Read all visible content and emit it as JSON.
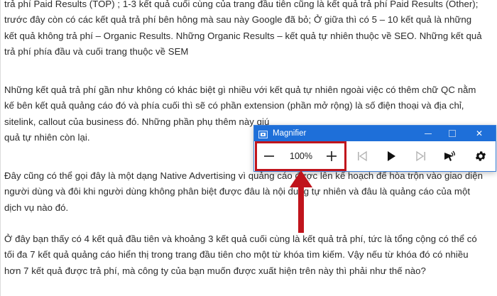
{
  "article": {
    "paragraphs": [
      {
        "lines": [
          "trả phí Paid Results (TOP) ; 1-3 kết quả cuối cùng của trang đầu tiên cũng là kết quả trả phí Paid Results (Other);",
          "trước đây còn có các kết quả trả phí bên hông mà sau này Google đã bỏ; Ở giữa thì có 5 – 10  kết quả là những",
          "kết quả không trả phí – Organic Results. Những Organic Results – kết quả tự nhiên thuộc về SEO. Những kết quả",
          "trả phí phía đầu và cuối trang thuộc về SEM"
        ]
      },
      {
        "lines": [
          "Những kết quả trả phí gần như không có khác biệt gì nhiều với kết quả tự nhiên ngoài việc có thêm chữ QC nằm",
          "kế bên kết quả quảng cáo đó và phía cuối thì sẽ có phần extension (phần mở rộng) là số điện thoại và địa chỉ,",
          "sitelink, callout của business đó. Những phần phụ thêm này giú",
          "quả tự nhiên còn lại."
        ]
      },
      {
        "lines": [
          "Đây cũng có thể gọi đây là một dạng Native Advertising vì quảng cáo được lên kế hoạch để hòa trộn vào giao diện",
          "người dùng và đôi khi người dùng không phân biệt được đâu là nội dung tự nhiên và đâu là quảng cáo của một",
          "dịch vụ nào đó."
        ]
      },
      {
        "lines": [
          "Ở đây bạn thấy có 4 kết quả đầu tiên và khoảng 3 kết quả cuối cùng là kết quả trả phí, tức là tổng cộng có thể có",
          "tối đa 7 kết quả quảng cáo hiển thị trong trang đầu tiên cho một từ khóa tìm kiếm. Vậy nếu từ khóa đó có nhiều",
          "hơn 7 kết quả được trả phí, mà công ty của bạn muốn được xuất hiện trên này thì phải như thế nào?"
        ]
      }
    ]
  },
  "magnifier": {
    "title": "Magnifier",
    "icon": "magnifier-app-icon",
    "zoom_level": "100%",
    "window_controls": {
      "minimize": "minimize-icon",
      "maximize": "maximize-icon",
      "close": "✕"
    },
    "toolbar": {
      "zoom_out": "minus-icon",
      "zoom_in": "plus-icon",
      "previous": "skip-previous-icon",
      "play": "play-icon",
      "next": "skip-next-icon",
      "read_from": "read-from-here-icon",
      "settings": "gear-icon"
    }
  },
  "annotation": {
    "highlight_color": "#c0141c",
    "titlebar_color": "#1e6fd9"
  }
}
